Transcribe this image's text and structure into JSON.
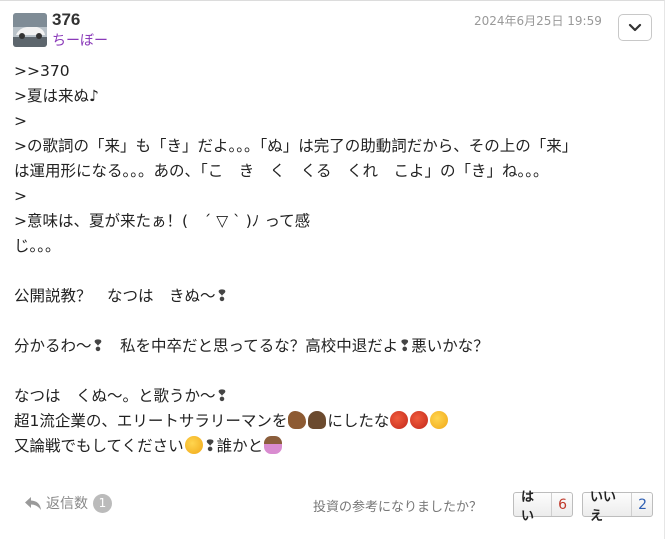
{
  "post": {
    "number": "376",
    "username": "ちーぼー",
    "timestamp": "2024年6月25日 19:59",
    "lines": [
      ">>370",
      ">夏は来ぬ♪",
      ">",
      ">の歌詞の「来」も「き」だよ。。。「ぬ」は完了の助動詞だから、その上の「来」",
      "は運用形になる。。。あの、「こ　き　く　くる　くれ　こよ」の「き」ね。。。",
      ">",
      ">意味は、夏が来たぁ！(　´ ▽ ` )ﾉ って感",
      "じ。。。",
      "",
      "公開説教？　なつは　きぬ〜",
      "",
      "分かるわ〜",
      "",
      "なつは　くぬ〜。と歌うか〜"
    ],
    "line12_rest": "　私を中卒だと思ってるな？高校中退だよ",
    "line12_end": "悪いかな？",
    "line15_a": "超1流企業の、エリートサラリーマンを",
    "line15_b": "にしたな",
    "line16_a": "又論戦でもしてください",
    "line16_b": "誰かと",
    "bang": "❢",
    "emoji": [
      "horse-emoji",
      "dog-emoji",
      "angry-face-emoji",
      "grinning-tongue-emoji",
      "smiling-face-emoji",
      "person-raising-hand-emoji"
    ]
  },
  "footer": {
    "reply_label": "返信数",
    "reply_count": "1",
    "question": "投資の参考になりましたか？",
    "yes_label": "はい",
    "yes_count": "6",
    "no_label": "いいえ",
    "no_count": "2"
  },
  "colors": {
    "username": "#8a3ab9",
    "yes_count": "#c0392b",
    "no_count": "#2f5fb3"
  }
}
